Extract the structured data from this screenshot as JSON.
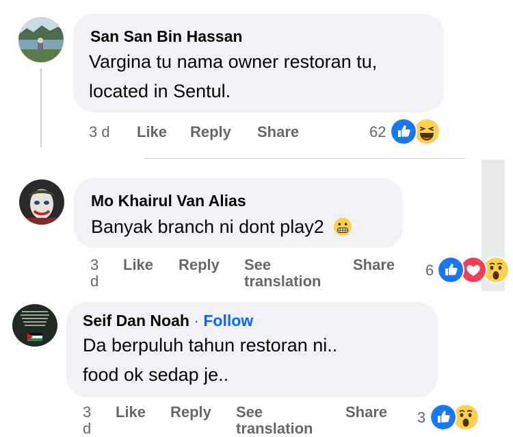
{
  "comments": [
    {
      "author": "San San Bin Hassan",
      "lines": [
        "Vargina tu nama owner restoran tu,",
        "located in Sentul."
      ],
      "time": "3 d",
      "like": "Like",
      "reply": "Reply",
      "share": "Share",
      "reaction_count": "62",
      "reactions": [
        "like-icon",
        "haha-icon"
      ]
    },
    {
      "author": "Mo Khairul Van Alias",
      "text": "Banyak branch ni dont play2",
      "emoji": "grimace-emoji",
      "time_lines": [
        "3",
        "d"
      ],
      "like": "Like",
      "reply": "Reply",
      "see_translation": [
        "See",
        "translation"
      ],
      "share": "Share",
      "reaction_count": "6",
      "reactions": [
        "like-icon",
        "love-icon",
        "wow-icon"
      ]
    },
    {
      "author": "Seif Dan Noah",
      "separator": "·",
      "follow": "Follow",
      "lines": [
        "Da berpuluh tahun restoran ni..",
        "food ok sedap je.."
      ],
      "time_lines": [
        "3",
        "d"
      ],
      "like": "Like",
      "reply": "Reply",
      "see_translation": [
        "See",
        "translation"
      ],
      "share": "Share",
      "reaction_count": "3",
      "reactions": [
        "like-icon",
        "wow-icon"
      ]
    }
  ],
  "colors": {
    "bubble": "#f0f2f5",
    "meta": "#65676b",
    "link": "#0866ff",
    "like": "#1877f2",
    "love": "#f33e58",
    "emoji": "#ffd050"
  }
}
